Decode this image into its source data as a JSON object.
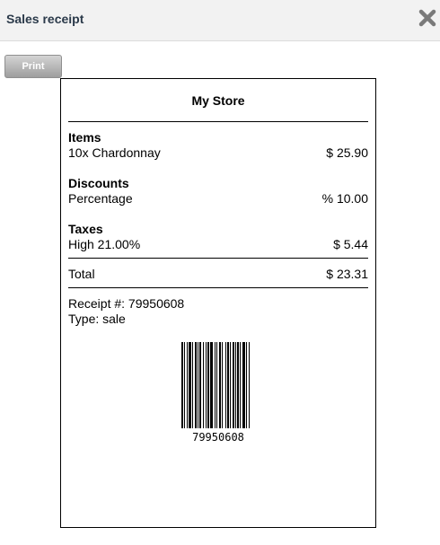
{
  "window": {
    "title": "Sales receipt",
    "close_icon": "close-icon"
  },
  "toolbar": {
    "print_label": "Print"
  },
  "receipt": {
    "store_name": "My Store",
    "sections": {
      "items": {
        "heading": "Items",
        "label": "10x Chardonnay",
        "value": "$ 25.90"
      },
      "discounts": {
        "heading": "Discounts",
        "label": "Percentage",
        "value": "% 10.00"
      },
      "taxes": {
        "heading": "Taxes",
        "label": "High 21.00%",
        "value": "$ 5.44"
      }
    },
    "total": {
      "label": "Total",
      "value": "$ 23.31"
    },
    "receipt_number": "Receipt #: 79950608",
    "type": "Type: sale",
    "barcode_text": "79950608"
  }
}
